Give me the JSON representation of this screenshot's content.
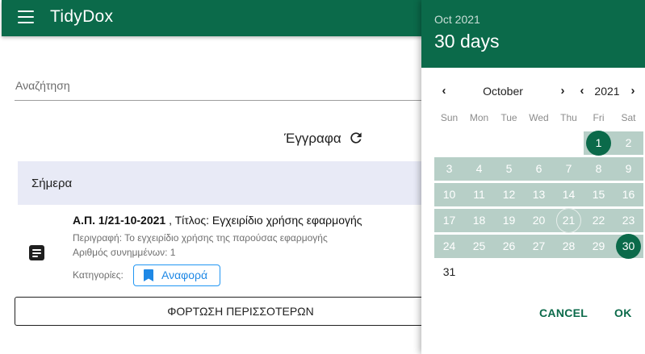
{
  "app": {
    "title": "TidyDox"
  },
  "search": {
    "label": "Αναζήτηση"
  },
  "documents": {
    "title": "Έγγραφα",
    "section_today": "Σήμερα",
    "item": {
      "id": "Α.Π. 1/21-10-2021",
      "title_rest": " , Τίτλος: Εγχειρίδιο χρήσης εφαρμογής",
      "description": "Περιγραφή: Το εγχειρίδιο χρήσης της παρούσας εφαρμογής",
      "attachments": "Αριθμός συνημμένων: 1",
      "categories_label": "Κατηγορίες:",
      "category": "Αναφορά"
    },
    "load_more": "ΦΟΡΤΩΣΗ ΠΕΡΙΣΣΟΤΕΡΩΝ"
  },
  "date_picker": {
    "header_sub": "Oct 2021",
    "header_main": "30 days",
    "month": "October",
    "year": "2021",
    "weekdays": [
      "Sun",
      "Mon",
      "Tue",
      "Wed",
      "Thu",
      "Fri",
      "Sat"
    ],
    "weeks": [
      [
        "",
        "",
        "",
        "",
        "",
        "1",
        "2"
      ],
      [
        "3",
        "4",
        "5",
        "6",
        "7",
        "8",
        "9"
      ],
      [
        "10",
        "11",
        "12",
        "13",
        "14",
        "15",
        "16"
      ],
      [
        "17",
        "18",
        "19",
        "20",
        "21",
        "22",
        "23"
      ],
      [
        "24",
        "25",
        "26",
        "27",
        "28",
        "29",
        "30"
      ],
      [
        "31",
        "",
        "",
        "",
        "",
        "",
        ""
      ]
    ],
    "range_start": 1,
    "range_end": 30,
    "today": 21,
    "cancel_label": "CANCEL",
    "ok_label": "OK"
  },
  "colors": {
    "primary": "#0b6a4a",
    "range": "#b7cfc7",
    "section_bg": "#e8eaf6",
    "chip": "#2196f3"
  },
  "icons": {
    "menu": "menu-icon",
    "refresh": "refresh-icon",
    "document": "document-icon",
    "bookmark": "bookmark-icon",
    "prev": "chevron-left-icon",
    "next": "chevron-right-icon",
    "year_next": "chevron-down-icon"
  }
}
